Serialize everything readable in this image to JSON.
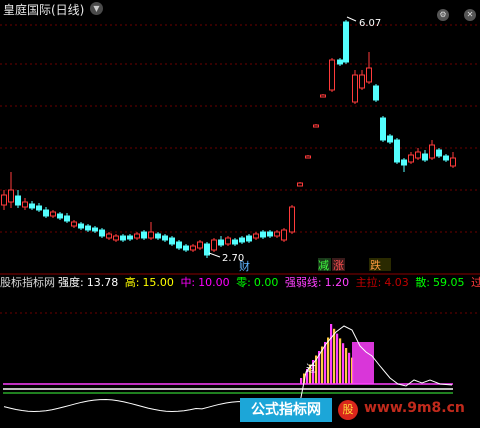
{
  "window": {
    "title": "皇庭国际(日线)",
    "dropdown_icon": "chevron-down-icon",
    "icons": [
      "settings-icon",
      "close-icon"
    ]
  },
  "price": {
    "high_label": "6.07",
    "low_label": "2.70"
  },
  "signals": {
    "cai": "财",
    "jian": "减",
    "zhang": "涨",
    "die": "跌"
  },
  "indicator": {
    "name": "股标指标网",
    "strength_label": "强度:",
    "strength_value": "13.78",
    "high_label": "高:",
    "high_value": "15.00",
    "mid_label": "中:",
    "mid_value": "10.00",
    "zero_label": "零:",
    "zero_value": "0.00",
    "weak_label": "强弱线:",
    "weak_value": "1.20",
    "main_label": "主拉:",
    "main_value": "4.03",
    "scatter_label": "散:",
    "scatter_value": "59.05",
    "overflow_text": "过"
  },
  "lower_signal": "过",
  "watermark": {
    "left": "公式指标网",
    "logo": "股",
    "url": "www.9m8.cn"
  },
  "colors": {
    "up": "#ff3b3b",
    "down": "#54ffff",
    "cash": "#ffff00",
    "mid": "#ff00ff",
    "zero": "#00ff00",
    "weak": "#ff40ff",
    "main": "#c00000",
    "scatter": "#00ff00"
  }
}
